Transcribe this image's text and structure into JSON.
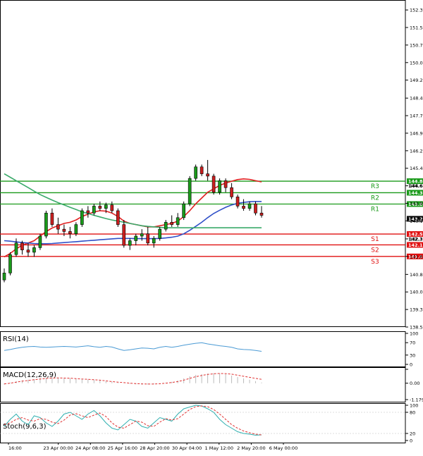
{
  "chart_data": {
    "type": "candlestick",
    "price_axis": {
      "ticks": [
        "152.30",
        "151.54",
        "150.78",
        "150.02",
        "149.26",
        "148.48",
        "147.72",
        "146.96",
        "146.20",
        "145.44",
        "144.68",
        "143.92",
        "143.16",
        "142.38",
        "141.62",
        "140.84",
        "140.08",
        "139.32",
        "138.56"
      ],
      "tick_values": [
        152.3,
        151.54,
        150.78,
        150.02,
        149.26,
        148.48,
        147.72,
        146.96,
        146.2,
        145.44,
        144.68,
        143.92,
        143.16,
        142.38,
        141.62,
        140.84,
        140.08,
        139.32,
        138.56
      ],
      "range": [
        138.56,
        152.64
      ]
    },
    "time_axis": {
      "labels": [
        "16:00",
        "23 Apr 00:00",
        "24 Apr 08:00",
        "25 Apr 16:00",
        "28 Apr 20:00",
        "30 Apr 04:00",
        "1 May 12:00",
        "2 May 20:00",
        "6 May 00:00"
      ]
    },
    "candles": [
      {
        "o": 140.6,
        "h": 141.1,
        "l": 140.5,
        "c": 140.9
      },
      {
        "o": 140.9,
        "h": 141.8,
        "l": 140.8,
        "c": 141.7
      },
      {
        "o": 141.7,
        "h": 142.4,
        "l": 141.6,
        "c": 142.2
      },
      {
        "o": 142.2,
        "h": 142.3,
        "l": 141.7,
        "c": 141.9
      },
      {
        "o": 141.9,
        "h": 142.2,
        "l": 141.6,
        "c": 141.8
      },
      {
        "o": 141.8,
        "h": 142.1,
        "l": 141.6,
        "c": 142.0
      },
      {
        "o": 142.0,
        "h": 142.6,
        "l": 141.9,
        "c": 142.5
      },
      {
        "o": 142.5,
        "h": 143.6,
        "l": 142.4,
        "c": 143.5
      },
      {
        "o": 143.5,
        "h": 143.7,
        "l": 142.9,
        "c": 143.0
      },
      {
        "o": 143.0,
        "h": 143.3,
        "l": 142.6,
        "c": 142.8
      },
      {
        "o": 142.8,
        "h": 143.0,
        "l": 142.5,
        "c": 142.7
      },
      {
        "o": 142.7,
        "h": 142.9,
        "l": 142.4,
        "c": 142.6
      },
      {
        "o": 142.6,
        "h": 143.1,
        "l": 142.5,
        "c": 143.0
      },
      {
        "o": 143.0,
        "h": 143.7,
        "l": 142.9,
        "c": 143.6
      },
      {
        "o": 143.6,
        "h": 143.8,
        "l": 143.3,
        "c": 143.5
      },
      {
        "o": 143.5,
        "h": 143.9,
        "l": 143.4,
        "c": 143.8
      },
      {
        "o": 143.8,
        "h": 144.0,
        "l": 143.6,
        "c": 143.7
      },
      {
        "o": 143.7,
        "h": 143.95,
        "l": 143.5,
        "c": 143.85
      },
      {
        "o": 143.85,
        "h": 144.0,
        "l": 143.5,
        "c": 143.6
      },
      {
        "o": 143.6,
        "h": 143.7,
        "l": 142.9,
        "c": 143.0
      },
      {
        "o": 143.0,
        "h": 143.2,
        "l": 142.0,
        "c": 142.1
      },
      {
        "o": 142.1,
        "h": 142.4,
        "l": 141.9,
        "c": 142.3
      },
      {
        "o": 142.3,
        "h": 142.6,
        "l": 142.1,
        "c": 142.5
      },
      {
        "o": 142.5,
        "h": 142.8,
        "l": 142.3,
        "c": 142.6
      },
      {
        "o": 142.6,
        "h": 142.9,
        "l": 142.1,
        "c": 142.2
      },
      {
        "o": 142.2,
        "h": 142.5,
        "l": 142.0,
        "c": 142.4
      },
      {
        "o": 142.4,
        "h": 142.9,
        "l": 142.3,
        "c": 142.8
      },
      {
        "o": 142.8,
        "h": 143.2,
        "l": 142.7,
        "c": 143.1
      },
      {
        "o": 143.1,
        "h": 143.4,
        "l": 142.9,
        "c": 143.0
      },
      {
        "o": 143.0,
        "h": 143.5,
        "l": 142.9,
        "c": 143.3
      },
      {
        "o": 143.3,
        "h": 144.0,
        "l": 143.2,
        "c": 143.9
      },
      {
        "o": 143.9,
        "h": 145.1,
        "l": 143.8,
        "c": 145.0
      },
      {
        "o": 145.0,
        "h": 145.6,
        "l": 144.9,
        "c": 145.5
      },
      {
        "o": 145.5,
        "h": 145.6,
        "l": 145.1,
        "c": 145.2
      },
      {
        "o": 145.2,
        "h": 145.8,
        "l": 144.9,
        "c": 145.1
      },
      {
        "o": 145.1,
        "h": 145.2,
        "l": 144.3,
        "c": 144.4
      },
      {
        "o": 144.4,
        "h": 145.0,
        "l": 144.3,
        "c": 144.9
      },
      {
        "o": 144.9,
        "h": 145.0,
        "l": 144.4,
        "c": 144.6
      },
      {
        "o": 144.6,
        "h": 144.8,
        "l": 144.1,
        "c": 144.2
      },
      {
        "o": 144.2,
        "h": 144.3,
        "l": 143.7,
        "c": 143.8
      },
      {
        "o": 143.8,
        "h": 144.1,
        "l": 143.6,
        "c": 143.7
      },
      {
        "o": 143.7,
        "h": 144.0,
        "l": 143.6,
        "c": 143.9
      },
      {
        "o": 143.9,
        "h": 144.0,
        "l": 143.4,
        "c": 143.5
      },
      {
        "o": 143.5,
        "h": 143.8,
        "l": 143.3,
        "c": 143.4
      }
    ],
    "series": [
      {
        "color": "#e02020",
        "values": [
          141.6,
          141.75,
          141.95,
          142.1,
          142.2,
          142.3,
          142.5,
          142.7,
          142.85,
          142.95,
          143.05,
          143.1,
          143.2,
          143.35,
          143.45,
          143.55,
          143.6,
          143.58,
          143.5,
          143.35,
          143.15,
          143.05,
          143.0,
          142.95,
          142.9,
          142.9,
          142.95,
          143.0,
          143.05,
          143.15,
          143.35,
          143.6,
          143.9,
          144.15,
          144.4,
          144.55,
          144.7,
          144.8,
          144.88,
          144.95,
          144.98,
          144.96,
          144.9,
          144.85
        ]
      },
      {
        "color": "#3050c8",
        "values": [
          142.3,
          142.28,
          142.25,
          142.22,
          142.2,
          142.18,
          142.17,
          142.17,
          142.18,
          142.2,
          142.22,
          142.24,
          142.26,
          142.28,
          142.3,
          142.32,
          142.34,
          142.36,
          142.38,
          142.4,
          142.4,
          142.4,
          142.39,
          142.39,
          142.39,
          142.39,
          142.4,
          142.42,
          142.45,
          142.5,
          142.6,
          142.75,
          142.92,
          143.1,
          143.3,
          143.48,
          143.62,
          143.75,
          143.85,
          143.92,
          143.96,
          143.99,
          144.0,
          144.0
        ]
      },
      {
        "color": "#3aaa6a",
        "values": [
          145.2,
          145.05,
          144.9,
          144.75,
          144.6,
          144.45,
          144.3,
          144.18,
          144.06,
          143.95,
          143.85,
          143.75,
          143.65,
          143.55,
          143.48,
          143.4,
          143.33,
          143.26,
          143.2,
          143.15,
          143.1,
          143.05,
          143.0,
          142.95,
          142.92,
          142.9,
          142.88,
          142.86,
          142.86,
          142.86,
          142.86,
          142.86,
          142.86,
          142.86,
          142.86,
          142.86,
          142.86,
          142.86,
          142.86,
          142.86,
          142.86,
          142.86,
          142.86,
          142.86
        ]
      }
    ],
    "levels": [
      {
        "name": "R3",
        "value": 144.88,
        "price_label": "144.88",
        "color": "#1a9a1a"
      },
      {
        "name": "",
        "value": 144.68,
        "price_label": "144.68",
        "color": ""
      },
      {
        "name": "R2",
        "value": 144.38,
        "price_label": "144.38",
        "color": "#1a9a1a"
      },
      {
        "name": "R1",
        "value": 143.89,
        "price_label": "143.89",
        "color": "#1a9a1a"
      },
      {
        "name": "",
        "value": 143.25,
        "price_label": "143.2",
        "color": "#000000"
      },
      {
        "name": "S1",
        "value": 142.59,
        "price_label": "142.59",
        "color": "#e01010"
      },
      {
        "name": "",
        "value": 142.38,
        "price_label": "142.38",
        "color": ""
      },
      {
        "name": "S2",
        "value": 142.12,
        "price_label": "142.12",
        "color": "#e01010"
      },
      {
        "name": "S3",
        "value": 141.62,
        "price_label": "141.62",
        "color": "#e01010"
      }
    ],
    "indicators": [
      {
        "label": "RSI(14)",
        "ticks": [
          "100",
          "70",
          "30",
          "0"
        ],
        "tick_values": [
          100,
          70,
          30,
          0
        ],
        "range": [
          0,
          100
        ],
        "color": "#4a9ad4",
        "values": [
          45,
          48,
          52,
          55,
          57,
          58,
          56,
          55,
          56,
          57,
          58,
          57,
          56,
          58,
          60,
          57,
          55,
          58,
          56,
          50,
          45,
          47,
          50,
          53,
          52,
          50,
          55,
          58,
          55,
          58,
          62,
          65,
          68,
          70,
          66,
          63,
          60,
          58,
          55,
          50,
          48,
          47,
          45,
          42
        ]
      },
      {
        "label": "MACD(12,26,9)",
        "ticks": [
          "",
          "0.00",
          "-1.1795"
        ],
        "tick_values": [
          1.0,
          0.0,
          -1.1795
        ],
        "range": [
          -1.1795,
          1.0
        ],
        "hist_color": "#bbbbbb",
        "signal_color": "#e03030",
        "hist": [
          -0.1,
          0.05,
          0.15,
          0.2,
          0.25,
          0.3,
          0.35,
          0.4,
          0.42,
          0.4,
          0.38,
          0.35,
          0.32,
          0.3,
          0.28,
          0.25,
          0.2,
          0.15,
          0.1,
          0.05,
          0.0,
          -0.05,
          -0.08,
          -0.1,
          -0.1,
          -0.08,
          -0.05,
          0.05,
          0.1,
          0.2,
          0.35,
          0.5,
          0.6,
          0.65,
          0.7,
          0.72,
          0.7,
          0.65,
          0.55,
          0.45,
          0.35,
          0.25,
          0.15,
          0.05
        ],
        "signal": [
          -0.05,
          0.0,
          0.08,
          0.15,
          0.2,
          0.25,
          0.3,
          0.34,
          0.37,
          0.38,
          0.37,
          0.36,
          0.33,
          0.3,
          0.28,
          0.25,
          0.22,
          0.17,
          0.12,
          0.08,
          0.04,
          0.0,
          -0.03,
          -0.05,
          -0.06,
          -0.06,
          -0.04,
          0.0,
          0.05,
          0.12,
          0.22,
          0.35,
          0.47,
          0.56,
          0.63,
          0.68,
          0.7,
          0.69,
          0.65,
          0.58,
          0.5,
          0.42,
          0.35,
          0.28
        ]
      },
      {
        "label": "Stoch(9,6,3)",
        "ticks": [
          "100",
          "80",
          "20",
          "0"
        ],
        "tick_values": [
          100,
          80,
          20,
          0
        ],
        "range": [
          0,
          100
        ],
        "k_color": "#30b0b0",
        "d_color": "#e03030",
        "k": [
          40,
          60,
          75,
          55,
          45,
          70,
          65,
          50,
          40,
          55,
          75,
          80,
          70,
          60,
          75,
          85,
          70,
          50,
          35,
          30,
          45,
          60,
          55,
          40,
          35,
          50,
          65,
          60,
          55,
          75,
          90,
          95,
          100,
          98,
          90,
          80,
          60,
          45,
          35,
          25,
          20,
          18,
          15,
          16
        ],
        "d": [
          45,
          50,
          60,
          65,
          58,
          55,
          62,
          60,
          52,
          48,
          58,
          72,
          76,
          70,
          65,
          72,
          78,
          68,
          50,
          38,
          35,
          45,
          55,
          52,
          42,
          40,
          52,
          62,
          58,
          62,
          75,
          88,
          96,
          98,
          96,
          88,
          75,
          60,
          45,
          35,
          27,
          22,
          18,
          16
        ]
      }
    ]
  }
}
